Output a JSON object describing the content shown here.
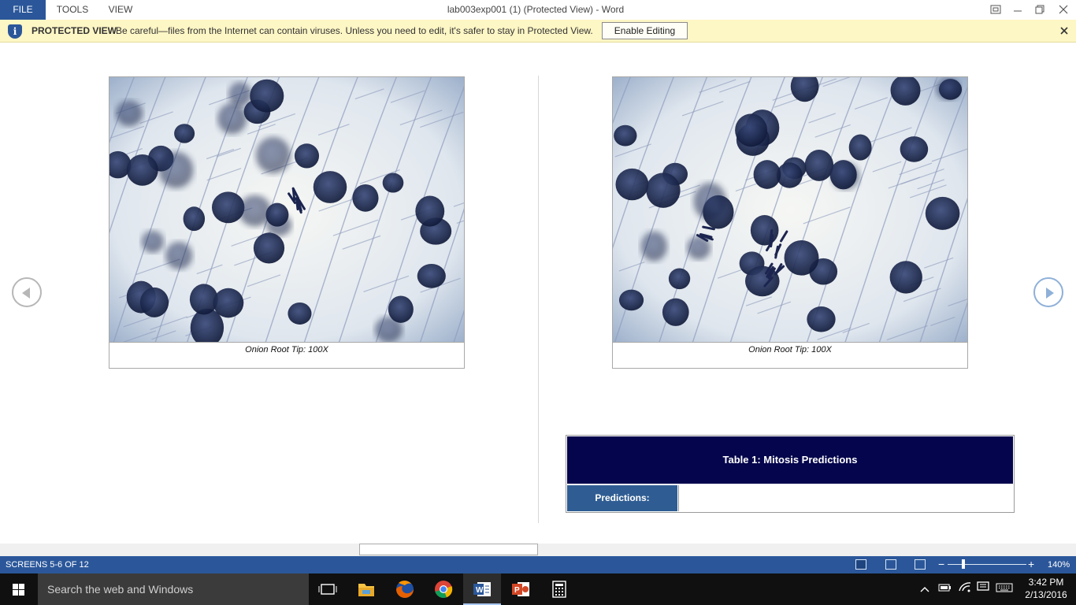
{
  "ribbon": {
    "tabs": [
      "FILE",
      "TOOLS",
      "VIEW"
    ],
    "window_title": "lab003exp001 (1) (Protected View) - Word"
  },
  "protected_view": {
    "label": "PROTECTED VIEW",
    "message": "Be careful—files from the Internet can contain viruses. Unless you need to edit, it's safer to stay in Protected View.",
    "button": "Enable Editing"
  },
  "document": {
    "left_figure": {
      "caption": "Onion Root Tip: 100X"
    },
    "right_figure": {
      "caption": "Onion Root Tip: 100X"
    },
    "table": {
      "title": "Table 1: Mitosis Predictions",
      "row_label": "Predictions:",
      "row_value": ""
    }
  },
  "status_bar": {
    "page_info": "SCREENS 5-6 OF 12",
    "zoom_level": "140%",
    "zoom_fraction": 0.2
  },
  "taskbar": {
    "search_placeholder": "Search the web and Windows",
    "time": "3:42 PM",
    "date": "2/13/2016",
    "apps": [
      "task-view-icon",
      "file-explorer-icon",
      "firefox-icon",
      "chrome-icon",
      "word-icon",
      "powerpoint-icon",
      "calculator-icon"
    ]
  },
  "colors": {
    "word_blue": "#2b579a",
    "protected_bar": "#fdf6c5",
    "table_header": "#05054d",
    "table_label": "#2f5d93"
  }
}
